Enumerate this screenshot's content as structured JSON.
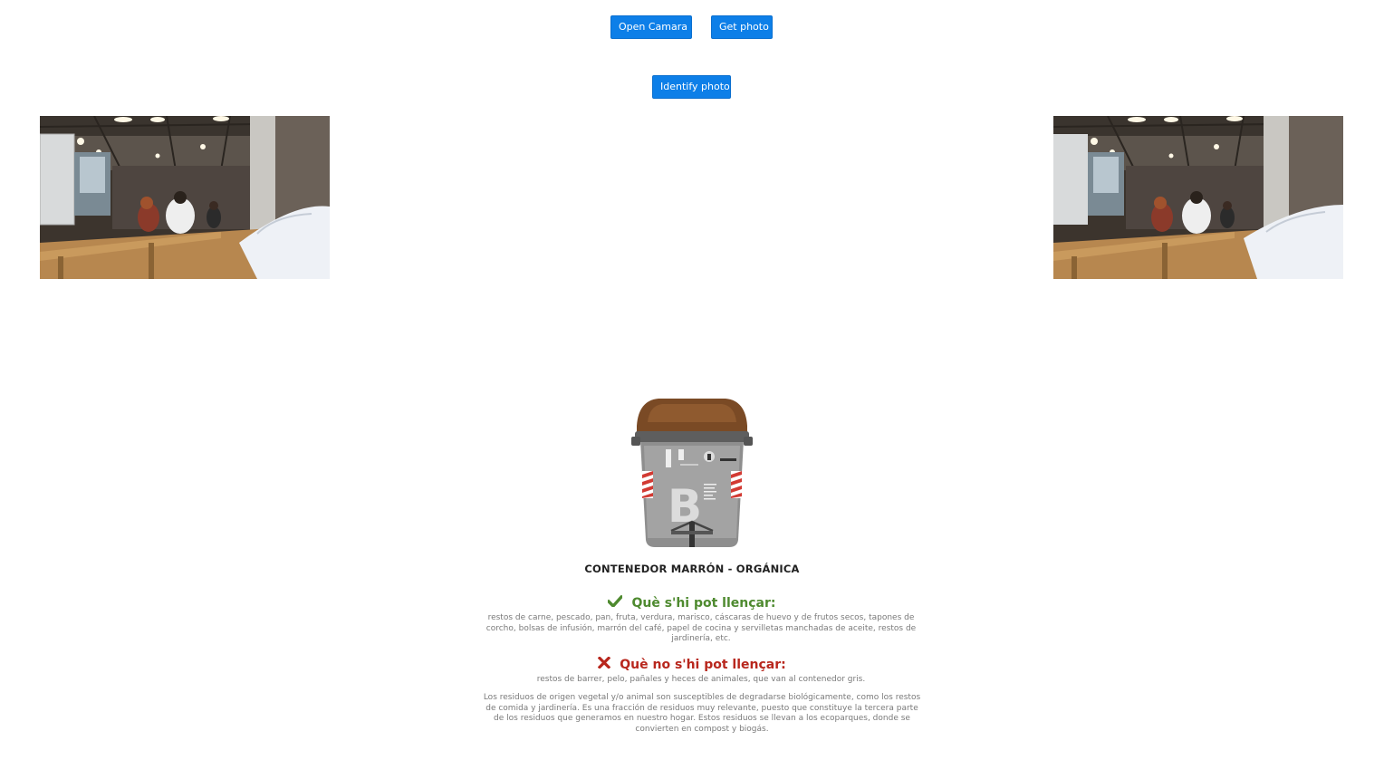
{
  "toolbar": {
    "open_camera_label": "Open Camara",
    "get_photo_label": "Get photo",
    "identify_label": "Identify photo"
  },
  "container": {
    "title": "CONTENEDOR MARRÓN - ORGÁNICA",
    "lid_color": "#7a4a25",
    "can_heading": "Què s'hi pot llençar:",
    "can_text": "restos de carne, pescado, pan, fruta, verdura, marisco, cáscaras de huevo y de frutos secos, tapones de corcho, bolsas de infusión, marrón del café, papel de cocina y servilletas manchadas de aceite, restos de jardinería, etc.",
    "cannot_heading": "Què no s'hi pot llençar:",
    "cannot_text": "restos de barrer, pelo, pañales y heces de animales, que van al contenedor gris.",
    "description": "Los residuos de origen vegetal y/o animal son susceptibles de degradarse biológicamente, como los restos de comida y jardinería. Es una fracción de residuos muy relevante, puesto que constituye la tercera parte de los residuos que generamos en nuestro hogar. Estos residuos se llevan a los ecoparques, donde se convierten en compost y biogás."
  },
  "colors": {
    "button_bg": "#0d7fe8",
    "can_green": "#4e8a2f",
    "cannot_red": "#b8271d"
  },
  "icons": {
    "can": "check-icon",
    "cannot": "cross-icon"
  }
}
